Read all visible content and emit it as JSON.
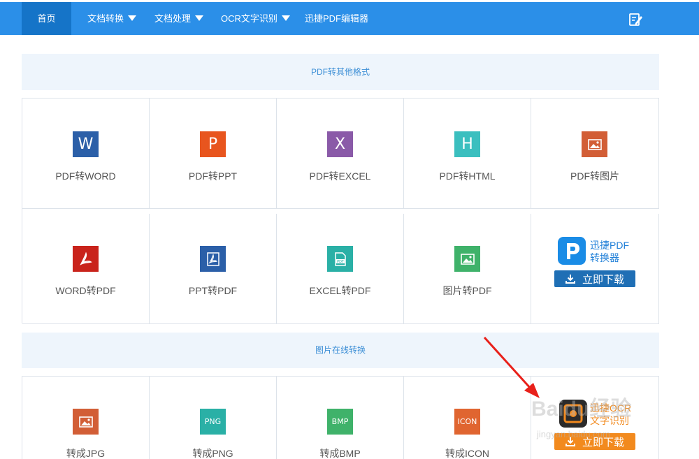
{
  "nav": {
    "items": [
      {
        "label": "首页",
        "dropdown": false
      },
      {
        "label": "文档转换",
        "dropdown": true
      },
      {
        "label": "文档处理",
        "dropdown": true
      },
      {
        "label": "OCR文字识别",
        "dropdown": true
      },
      {
        "label": "迅捷PDF编辑器",
        "dropdown": false
      }
    ],
    "edit_icon": "edit-note-icon",
    "bg_color": "#2b8fe8",
    "active_color": "#1574c8"
  },
  "sections": [
    {
      "title": "PDF转其他格式",
      "rows": [
        [
          {
            "label": "PDF转WORD",
            "glyph": "W",
            "icon": "word-icon",
            "color": "#2b5fa8"
          },
          {
            "label": "PDF转PPT",
            "glyph": "P",
            "icon": "ppt-icon",
            "color": "#e8551e"
          },
          {
            "label": "PDF转EXCEL",
            "glyph": "X",
            "icon": "excel-icon",
            "color": "#8a5aa8"
          },
          {
            "label": "PDF转HTML",
            "glyph": "H",
            "icon": "html-icon",
            "color": "#3bbfbf"
          },
          {
            "label": "PDF转图片",
            "glyph": "",
            "icon": "image-icon",
            "color": "#d25e36"
          }
        ],
        [
          {
            "label": "WORD转PDF",
            "glyph": "",
            "icon": "acrobat-icon",
            "color": "#c9231b"
          },
          {
            "label": "PPT转PDF",
            "glyph": "",
            "icon": "pdf-doc-icon",
            "color": "#2b5fa8"
          },
          {
            "label": "EXCEL转PDF",
            "glyph": "",
            "icon": "pdf-file-icon",
            "color": "#2ab0a6"
          },
          {
            "label": "图片转PDF",
            "glyph": "",
            "icon": "image-icon",
            "color": "#3fb26a"
          }
        ]
      ],
      "promo": {
        "line1": "迅捷PDF",
        "line2": "转换器",
        "button": "立即下载",
        "logo_color": "#1a8ce6",
        "button_color": "#1f6fb5"
      }
    },
    {
      "title": "图片在线转换",
      "rows": [
        [
          {
            "label": "转成JPG",
            "glyph": "",
            "icon": "image-icon",
            "color": "#d25e36"
          },
          {
            "label": "转成PNG",
            "glyph": "PNG",
            "icon": "png-icon",
            "color": "#2ab0a6"
          },
          {
            "label": "转成BMP",
            "glyph": "BMP",
            "icon": "bmp-icon",
            "color": "#3fb26a"
          },
          {
            "label": "转成ICON",
            "glyph": "ICON",
            "icon": "icon-format-icon",
            "color": "#e06530"
          }
        ]
      ],
      "promo": {
        "line1": "迅捷OCR",
        "line2": "文字识别",
        "button": "立即下载",
        "logo_color": "#2b2b2b",
        "button_color": "#f28a1e"
      }
    }
  ],
  "watermark": {
    "text": "Baidu经验",
    "sub": "jingyan.baidu.com"
  }
}
